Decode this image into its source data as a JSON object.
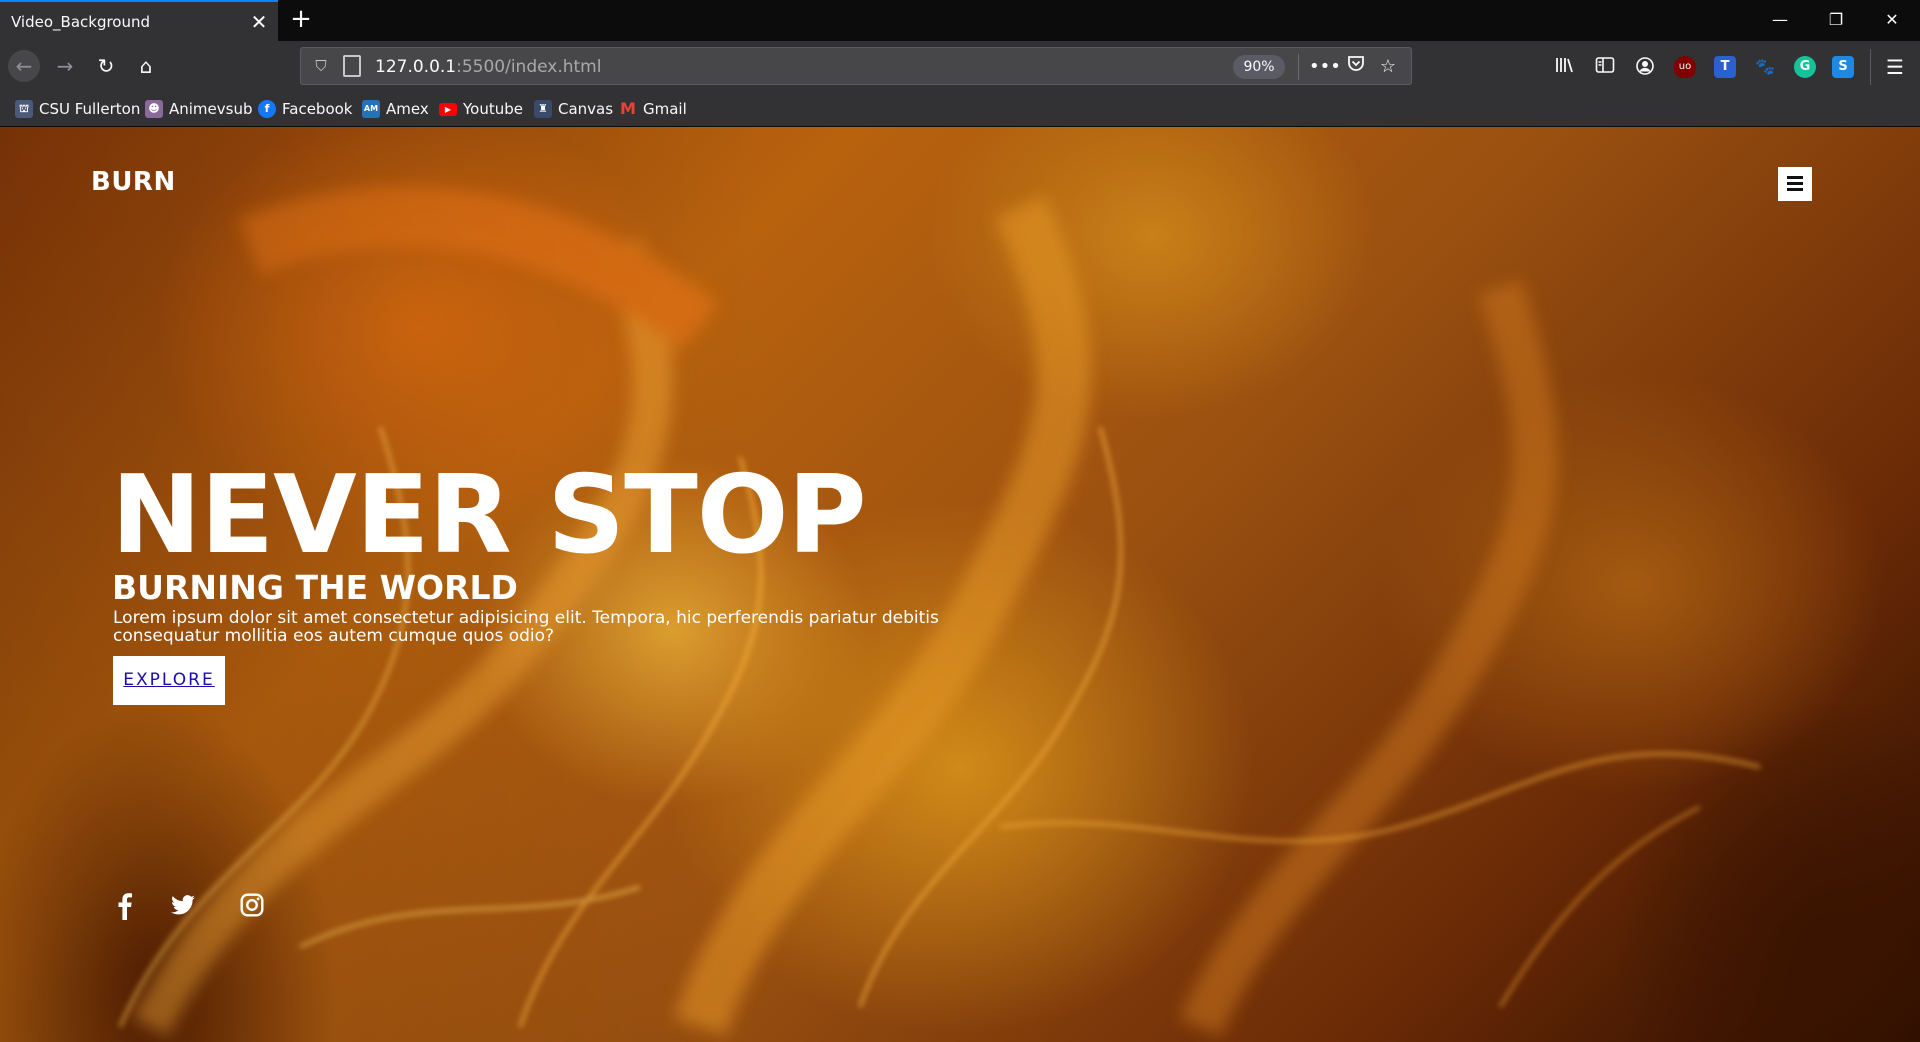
{
  "browser": {
    "tab_title": "Video_Background",
    "url_host": "127.0.0.1",
    "url_path": ":5500/index.html",
    "zoom": "90%",
    "bookmarks": [
      {
        "label": "CSU Fullerton",
        "icon": "csuf-icon",
        "color": "#4a5a78"
      },
      {
        "label": "Animevsub",
        "icon": "animevsub-icon",
        "color": "#8a6a9a"
      },
      {
        "label": "Facebook",
        "icon": "facebook-icon",
        "color": "#1877f2"
      },
      {
        "label": "Amex",
        "icon": "amex-icon",
        "color": "#2671b9"
      },
      {
        "label": "Youtube",
        "icon": "youtube-icon",
        "color": "#ff0000"
      },
      {
        "label": "Canvas",
        "icon": "canvas-icon",
        "color": "#3a4a6a"
      },
      {
        "label": "Gmail",
        "icon": "gmail-icon",
        "color": "#ea4335"
      }
    ]
  },
  "page": {
    "logo": "BURN",
    "hero_title": "NEVER STOP",
    "hero_subtitle": "BURNING THE WORLD",
    "hero_text": "Lorem ipsum dolor sit amet consectetur adipisicing elit. Tempora, hic perferendis pariatur debitis consequatur mollitia eos autem cumque quos odio?",
    "cta_label": "EXPLORE",
    "social": [
      "facebook-icon",
      "twitter-icon",
      "instagram-icon"
    ],
    "accent": "#e07a10"
  }
}
